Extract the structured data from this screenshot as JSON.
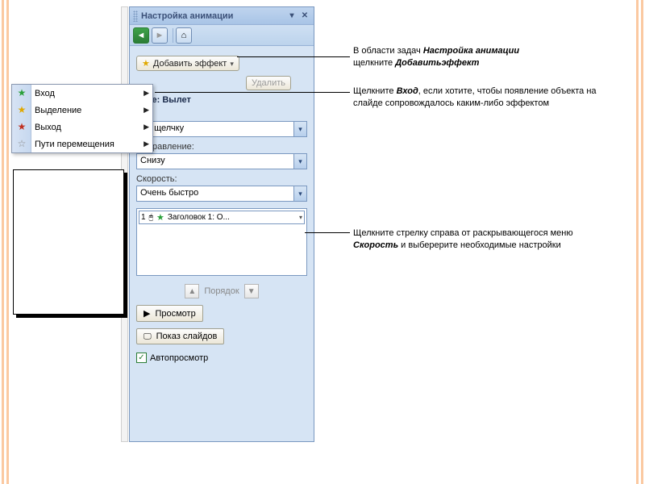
{
  "pane": {
    "title": "Настройка анимации",
    "add_effect_label": "Добавить эффект",
    "remove_label": "Удалить",
    "change_label": "ение: Вылет",
    "start_label": "ло:",
    "start_value": "По щелчку",
    "direction_label": "Направление:",
    "direction_value": "Снизу",
    "speed_label": "Скорость:",
    "speed_value": "Очень быстро",
    "anim_item_num": "1",
    "anim_item_text": "Заголовок 1: О...",
    "order_label": "Порядок",
    "preview_label": "Просмотр",
    "slideshow_label": "Показ слайдов",
    "autopreview_label": "Автопросмотр"
  },
  "menu": {
    "items": [
      {
        "label": "Вход",
        "icon": "star",
        "color": "green"
      },
      {
        "label": "Выделение",
        "icon": "star",
        "color": "yellow"
      },
      {
        "label": "Выход",
        "icon": "star",
        "color": "red"
      },
      {
        "label": "Пути перемещения",
        "icon": "star",
        "color": "grey"
      }
    ]
  },
  "callouts": {
    "c1a": "В области задач ",
    "c1b": "Настройка анимации",
    "c1c": " щелкните ",
    "c1d": "Добавитьэффект",
    "c2a": "Щелкните ",
    "c2b": "Вход",
    "c2c": ", если хотите, чтобы появление объекта на слайде сопровождалось каким-либо эффектом",
    "c3a": "Щелкните стрелку справа от раскрывающегося меню ",
    "c3b": "Скорость",
    "c3c": " и выберерите необходимые настройки"
  }
}
